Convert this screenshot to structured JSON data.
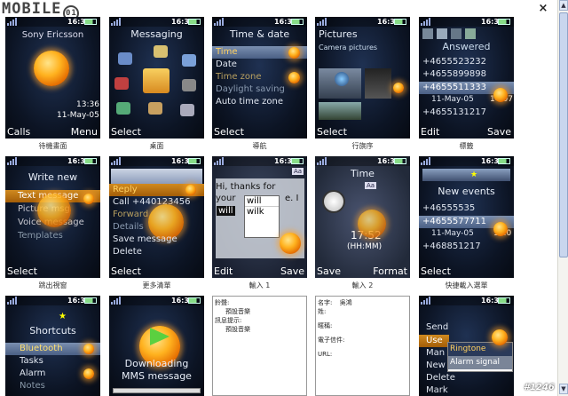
{
  "window": {
    "close_symbol": "×",
    "logo": "MOBILE",
    "logo_ring": "01",
    "watermark": "#1246"
  },
  "status": {
    "time": "16:34"
  },
  "screens": {
    "s1": {
      "operator": "Sony Ericsson",
      "clock": "13:36",
      "date": "11-May-05",
      "left": "Calls",
      "right": "Menu",
      "caption": "待機畫面"
    },
    "s2": {
      "title": "Messaging",
      "left": "Select",
      "caption": "桌面"
    },
    "s3": {
      "title": "Time & date",
      "items": [
        "Time",
        "Date",
        "Time zone",
        "Daylight saving",
        "Auto time zone"
      ],
      "left": "Select",
      "caption": "導航"
    },
    "s4": {
      "title": "Pictures",
      "subtitle": "Camera pictures",
      "left": "Select",
      "caption": "行旗序"
    },
    "s5": {
      "title": "Answered",
      "items": [
        "+4655523232",
        "+4655899898",
        "+4655511333",
        "11-May-05",
        "+4655131217"
      ],
      "date_time": "14:07",
      "left": "Edit",
      "right": "Save",
      "caption": "標籤"
    },
    "s6": {
      "title": "Write new",
      "items": [
        "Text message",
        "Picture msg",
        "Voice message",
        "Templates"
      ],
      "left": "Select",
      "caption": "跳出視窗"
    },
    "s7": {
      "items": [
        "Reply",
        "Call +440123456",
        "Forward",
        "Details",
        "Save message",
        "Delete"
      ],
      "left": "Select",
      "caption": "更多清單"
    },
    "s8": {
      "badge": "Aa",
      "text1": "Hi, thanks for",
      "text2": "your",
      "text3": "e. I",
      "typed": "will",
      "sugg1": "will",
      "sugg2": "wilk",
      "left": "Edit",
      "right": "Save",
      "caption": "輸入 1"
    },
    "s9": {
      "title": "Time",
      "badge": "Aa",
      "time": "17:52",
      "format": "(HH:MM)",
      "left": "Save",
      "right": "Format",
      "caption": "輸入 2"
    },
    "s10": {
      "title": "New events",
      "items": [
        "+46555535",
        "+4655577711",
        "11-May-05",
        "+468851217"
      ],
      "date_time": "14:0",
      "left": "Select",
      "caption": "快捷載入選單"
    },
    "s11": {
      "title": "Shortcuts",
      "items": [
        "Bluetooth",
        "Tasks",
        "Alarm",
        "Notes"
      ]
    },
    "s12": {
      "title": "Downloading",
      "subtitle": "MMS message"
    },
    "f1": {
      "l1": "鈴聲:",
      "l2": "預設音樂",
      "l3": "訊息提示:",
      "l4": "預設音樂"
    },
    "f2": {
      "l1": "名字:",
      "l1v": "吳鴻",
      "l2": "姓:",
      "l3": "暱稱:",
      "l4": "電子信件:",
      "l5": "URL:"
    },
    "s14": {
      "items": [
        "Send",
        "Use",
        "Man",
        "New",
        "Delete",
        "Mark"
      ],
      "popup1": "Ringtone",
      "popup2": "Alarm signal"
    }
  },
  "colors": {
    "highlight": "#6c82a8",
    "accent_orange": "#ffb21f",
    "background": "#ffffff"
  }
}
